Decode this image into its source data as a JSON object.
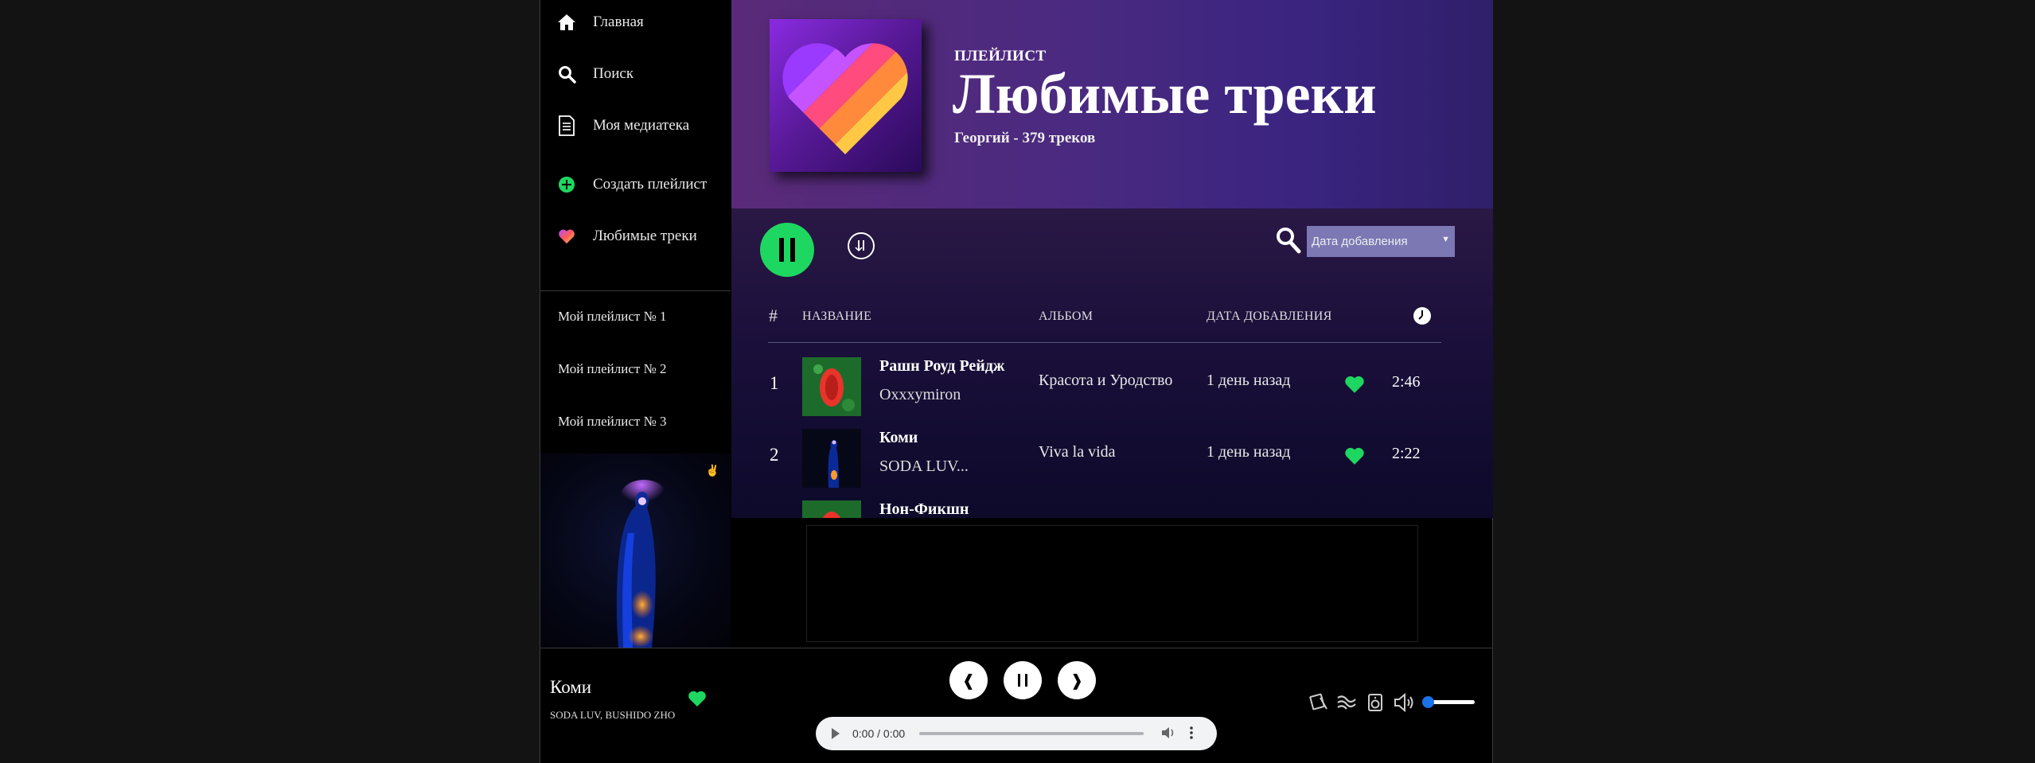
{
  "sidebar": {
    "nav": [
      {
        "label": "Главная",
        "icon": "home-icon"
      },
      {
        "label": "Поиск",
        "icon": "search-icon"
      },
      {
        "label": "Моя медиатека",
        "icon": "library-icon"
      },
      {
        "label": "Создать плейлист",
        "icon": "add-circle-icon"
      },
      {
        "label": "Любимые треки",
        "icon": "heart-icon"
      }
    ],
    "playlists": [
      "Мой плейлист № 1",
      "Мой плейлист № 2",
      "Мой плейлист № 3"
    ]
  },
  "header": {
    "label": "ПЛЕЙЛИСТ",
    "title": "Любимые треки",
    "meta": "Георгий - 379 треков"
  },
  "toolbar": {
    "sort_selected": "Дата добавления"
  },
  "table": {
    "columns": {
      "num": "#",
      "title": "НАЗВАНИЕ",
      "album": "АЛЬБОМ",
      "date": "ДАТА ДОБАВЛЕНИЯ"
    },
    "rows": [
      {
        "num": "1",
        "title": "Рашн Роуд Рейдж",
        "artist": "Oxxxymiron",
        "album": "Красота и Уродство",
        "date": "1 день назад",
        "duration": "2:46",
        "liked": true
      },
      {
        "num": "2",
        "title": "Коми",
        "artist": "SODA LUV...",
        "album": "Viva la vida",
        "date": "1 день назад",
        "duration": "2:22",
        "liked": true
      },
      {
        "num": "",
        "title": "Нон-Фикшн",
        "artist": "",
        "album": "",
        "date": "",
        "duration": "",
        "liked": false
      }
    ]
  },
  "player": {
    "title": "Коми",
    "artist": "SODA LUV, BUSHIDO ZHO",
    "time": "0:00 / 0:00",
    "volume": 0.1
  },
  "colors": {
    "accent": "#1ed760",
    "volume": "#1a73e8"
  }
}
